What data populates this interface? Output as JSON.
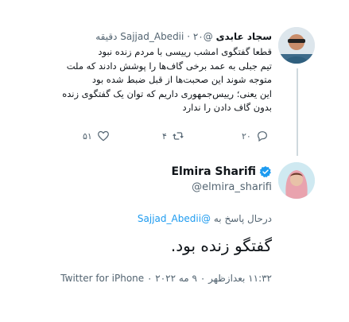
{
  "quoted": {
    "name": "سجاد عابدی",
    "handle": "@Sajjad_Abedii",
    "time": "۲۰ دقیقه",
    "body_lines": [
      "قطعا گفتگوی امشب رییسی با مردم زنده نبود",
      "تیم جبلی به عمد برخی گاف‌ها را پوشش دادند که ملت",
      "متوجه شوند این صحبت‌ها از قبل ضبط شده بود",
      "این یعنی؛ رییس‌جمهوری داریم که توان یک گفتگوی زنده",
      "بدون گاف دادن را ندارد"
    ],
    "reply_count": "۲۰",
    "retweet_count": "۴",
    "like_count": "۵۱"
  },
  "tweet": {
    "author_name": "Elmira Sharifi",
    "author_handle": "@elmira_sharifi",
    "reply_label": "درحال پاسخ به",
    "reply_handle": "@Sajjad_Abedii",
    "text": "گفتگو زنده بود.",
    "footer": "۱۱:۳۲ بعدازظهر ۰ ۹ مه ۲۰۲۲ ۰ Twitter for iPhone"
  },
  "icons": {
    "reply": "reply-icon",
    "retweet": "retweet-icon",
    "like": "like-icon",
    "verified": "verified-badge-icon"
  },
  "colors": {
    "accent": "#1d9bf0",
    "muted": "#536471",
    "thread_line": "#cfd9de"
  }
}
